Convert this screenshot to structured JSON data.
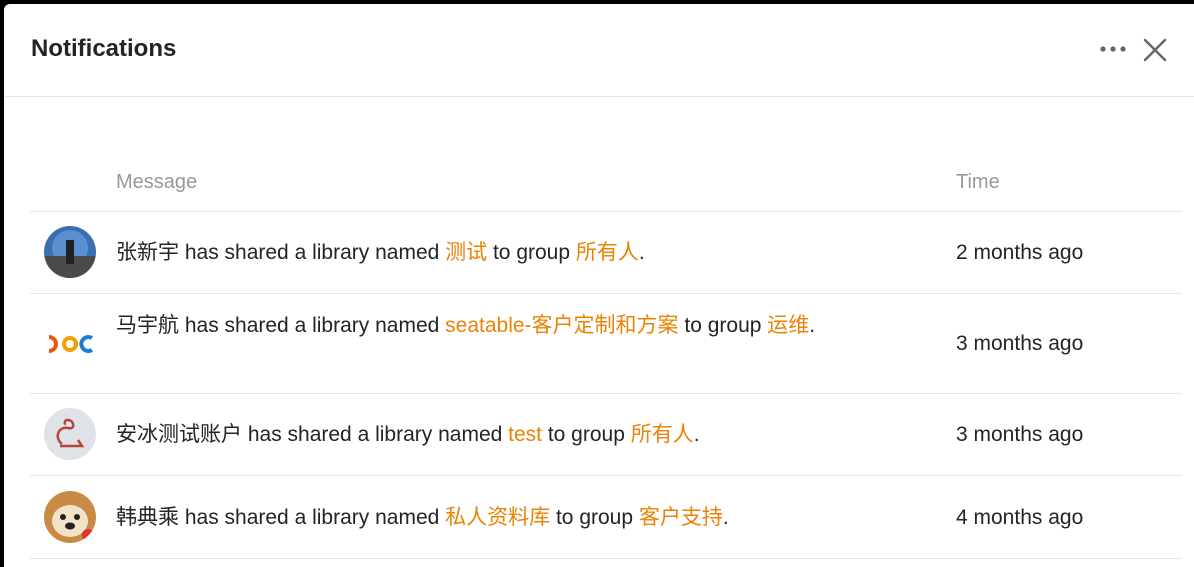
{
  "header": {
    "title": "Notifications",
    "more_icon": "more-horizontal-icon",
    "close_icon": "close-icon"
  },
  "table": {
    "columns": {
      "message": "Message",
      "time": "Time"
    },
    "rows": [
      {
        "user": "张新宇",
        "text1": " has shared a library named ",
        "library": "测试",
        "text2": " to group ",
        "group": "所有人",
        "end": ".",
        "time": "2 months ago"
      },
      {
        "user": "马宇航",
        "text1": " has shared a library named ",
        "library": "seatable-客户定制和方案",
        "text2": " to group ",
        "group": "运维",
        "end": ".",
        "time": "3 months ago"
      },
      {
        "user": "安冰测试账户",
        "text1": " has shared a library named ",
        "library": "test",
        "text2": " to group ",
        "group": "所有人",
        "end": ".",
        "time": "3 months ago"
      },
      {
        "user": "韩典乘",
        "text1": " has shared a library named ",
        "library": "私人资料库",
        "text2": " to group ",
        "group": "客户支持",
        "end": ".",
        "time": "4 months ago"
      }
    ]
  },
  "colors": {
    "link": "#eb8205",
    "header_text": "#999999"
  }
}
